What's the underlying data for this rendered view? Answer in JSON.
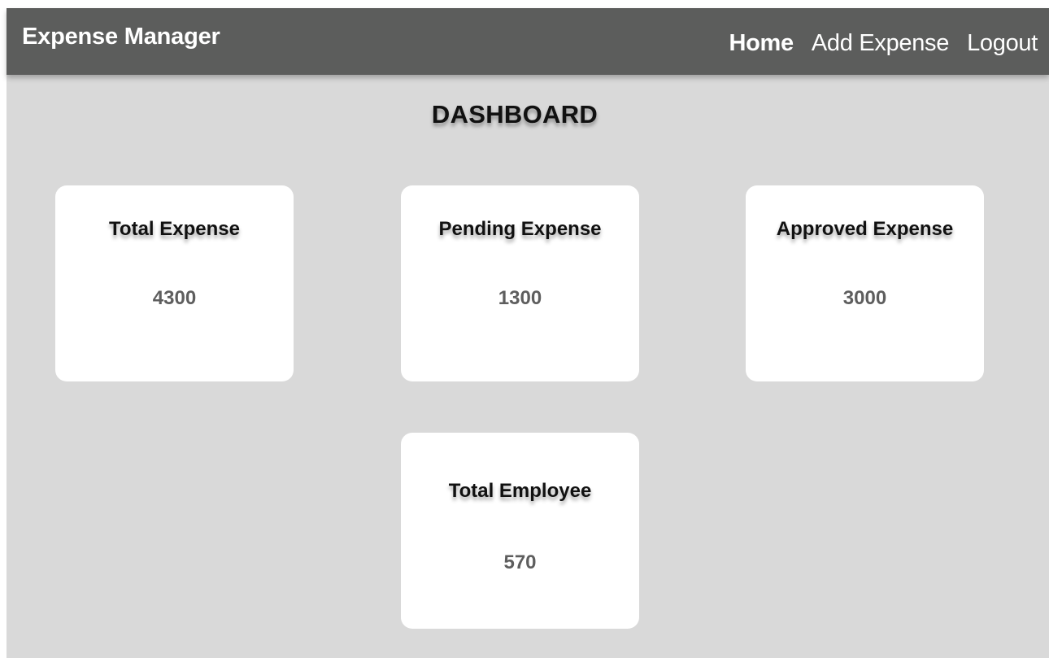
{
  "navbar": {
    "brand": "Expense Manager",
    "links": [
      {
        "label": "Home",
        "active": true
      },
      {
        "label": "Add Expense",
        "active": false
      },
      {
        "label": "Logout",
        "active": false
      }
    ]
  },
  "page": {
    "title": "DASHBOARD"
  },
  "cards": [
    {
      "title": "Total Expense",
      "value": "4300"
    },
    {
      "title": "Pending Expense",
      "value": "1300"
    },
    {
      "title": "Approved Expense",
      "value": "3000"
    },
    {
      "title": "Total Employee",
      "value": "570"
    }
  ],
  "colors": {
    "navbar": "#5c5d5c",
    "background": "#d9d9d9",
    "card": "#ffffff",
    "value_text": "#5e5e5e"
  }
}
